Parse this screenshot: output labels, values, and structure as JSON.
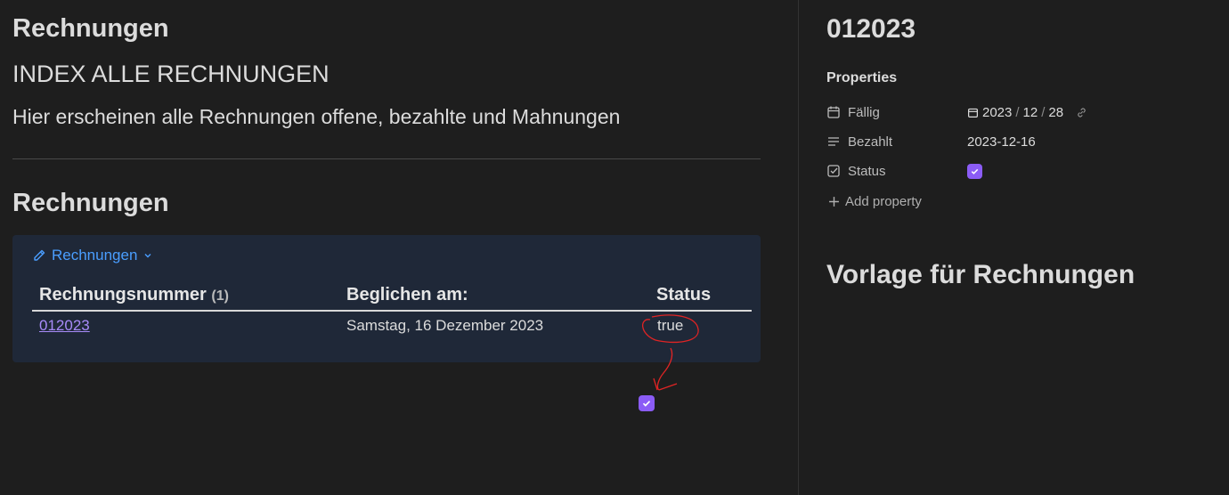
{
  "left": {
    "heading1": "Rechnungen",
    "heading2": "INDEX ALLE RECHNUNGEN",
    "intro": "Hier erscheinen alle Rechnungen offene, bezahlte und Mahnungen",
    "heading3": "Rechnungen",
    "base": {
      "view_label": "Rechnungen",
      "columns": [
        {
          "label": "Rechnungsnummer",
          "count": "(1)"
        },
        {
          "label": "Beglichen am:"
        },
        {
          "label": "Status"
        }
      ],
      "rows": [
        {
          "number": "012023",
          "paid_on": "Samstag, 16 Dezember 2023",
          "status": "true"
        }
      ]
    },
    "annotation_color": "#e02424"
  },
  "right": {
    "title": "012023",
    "properties_heading": "Properties",
    "properties": [
      {
        "key": "Fällig",
        "icon": "calendar-icon",
        "value_parts": [
          "2023",
          "12",
          "28"
        ],
        "separator": "/"
      },
      {
        "key": "Bezahlt",
        "icon": "text-lines-icon",
        "value": "2023-12-16"
      },
      {
        "key": "Status",
        "icon": "checkbox-icon",
        "checked": true
      }
    ],
    "add_property": "Add property",
    "template_heading": "Vorlage für Rechnungen"
  },
  "colors": {
    "background": "#1e1e1e",
    "base_background": "#1f2838",
    "accent_link": "#4a9eff",
    "internal_link": "#a88bfa",
    "checkbox": "#8b5cf6"
  }
}
